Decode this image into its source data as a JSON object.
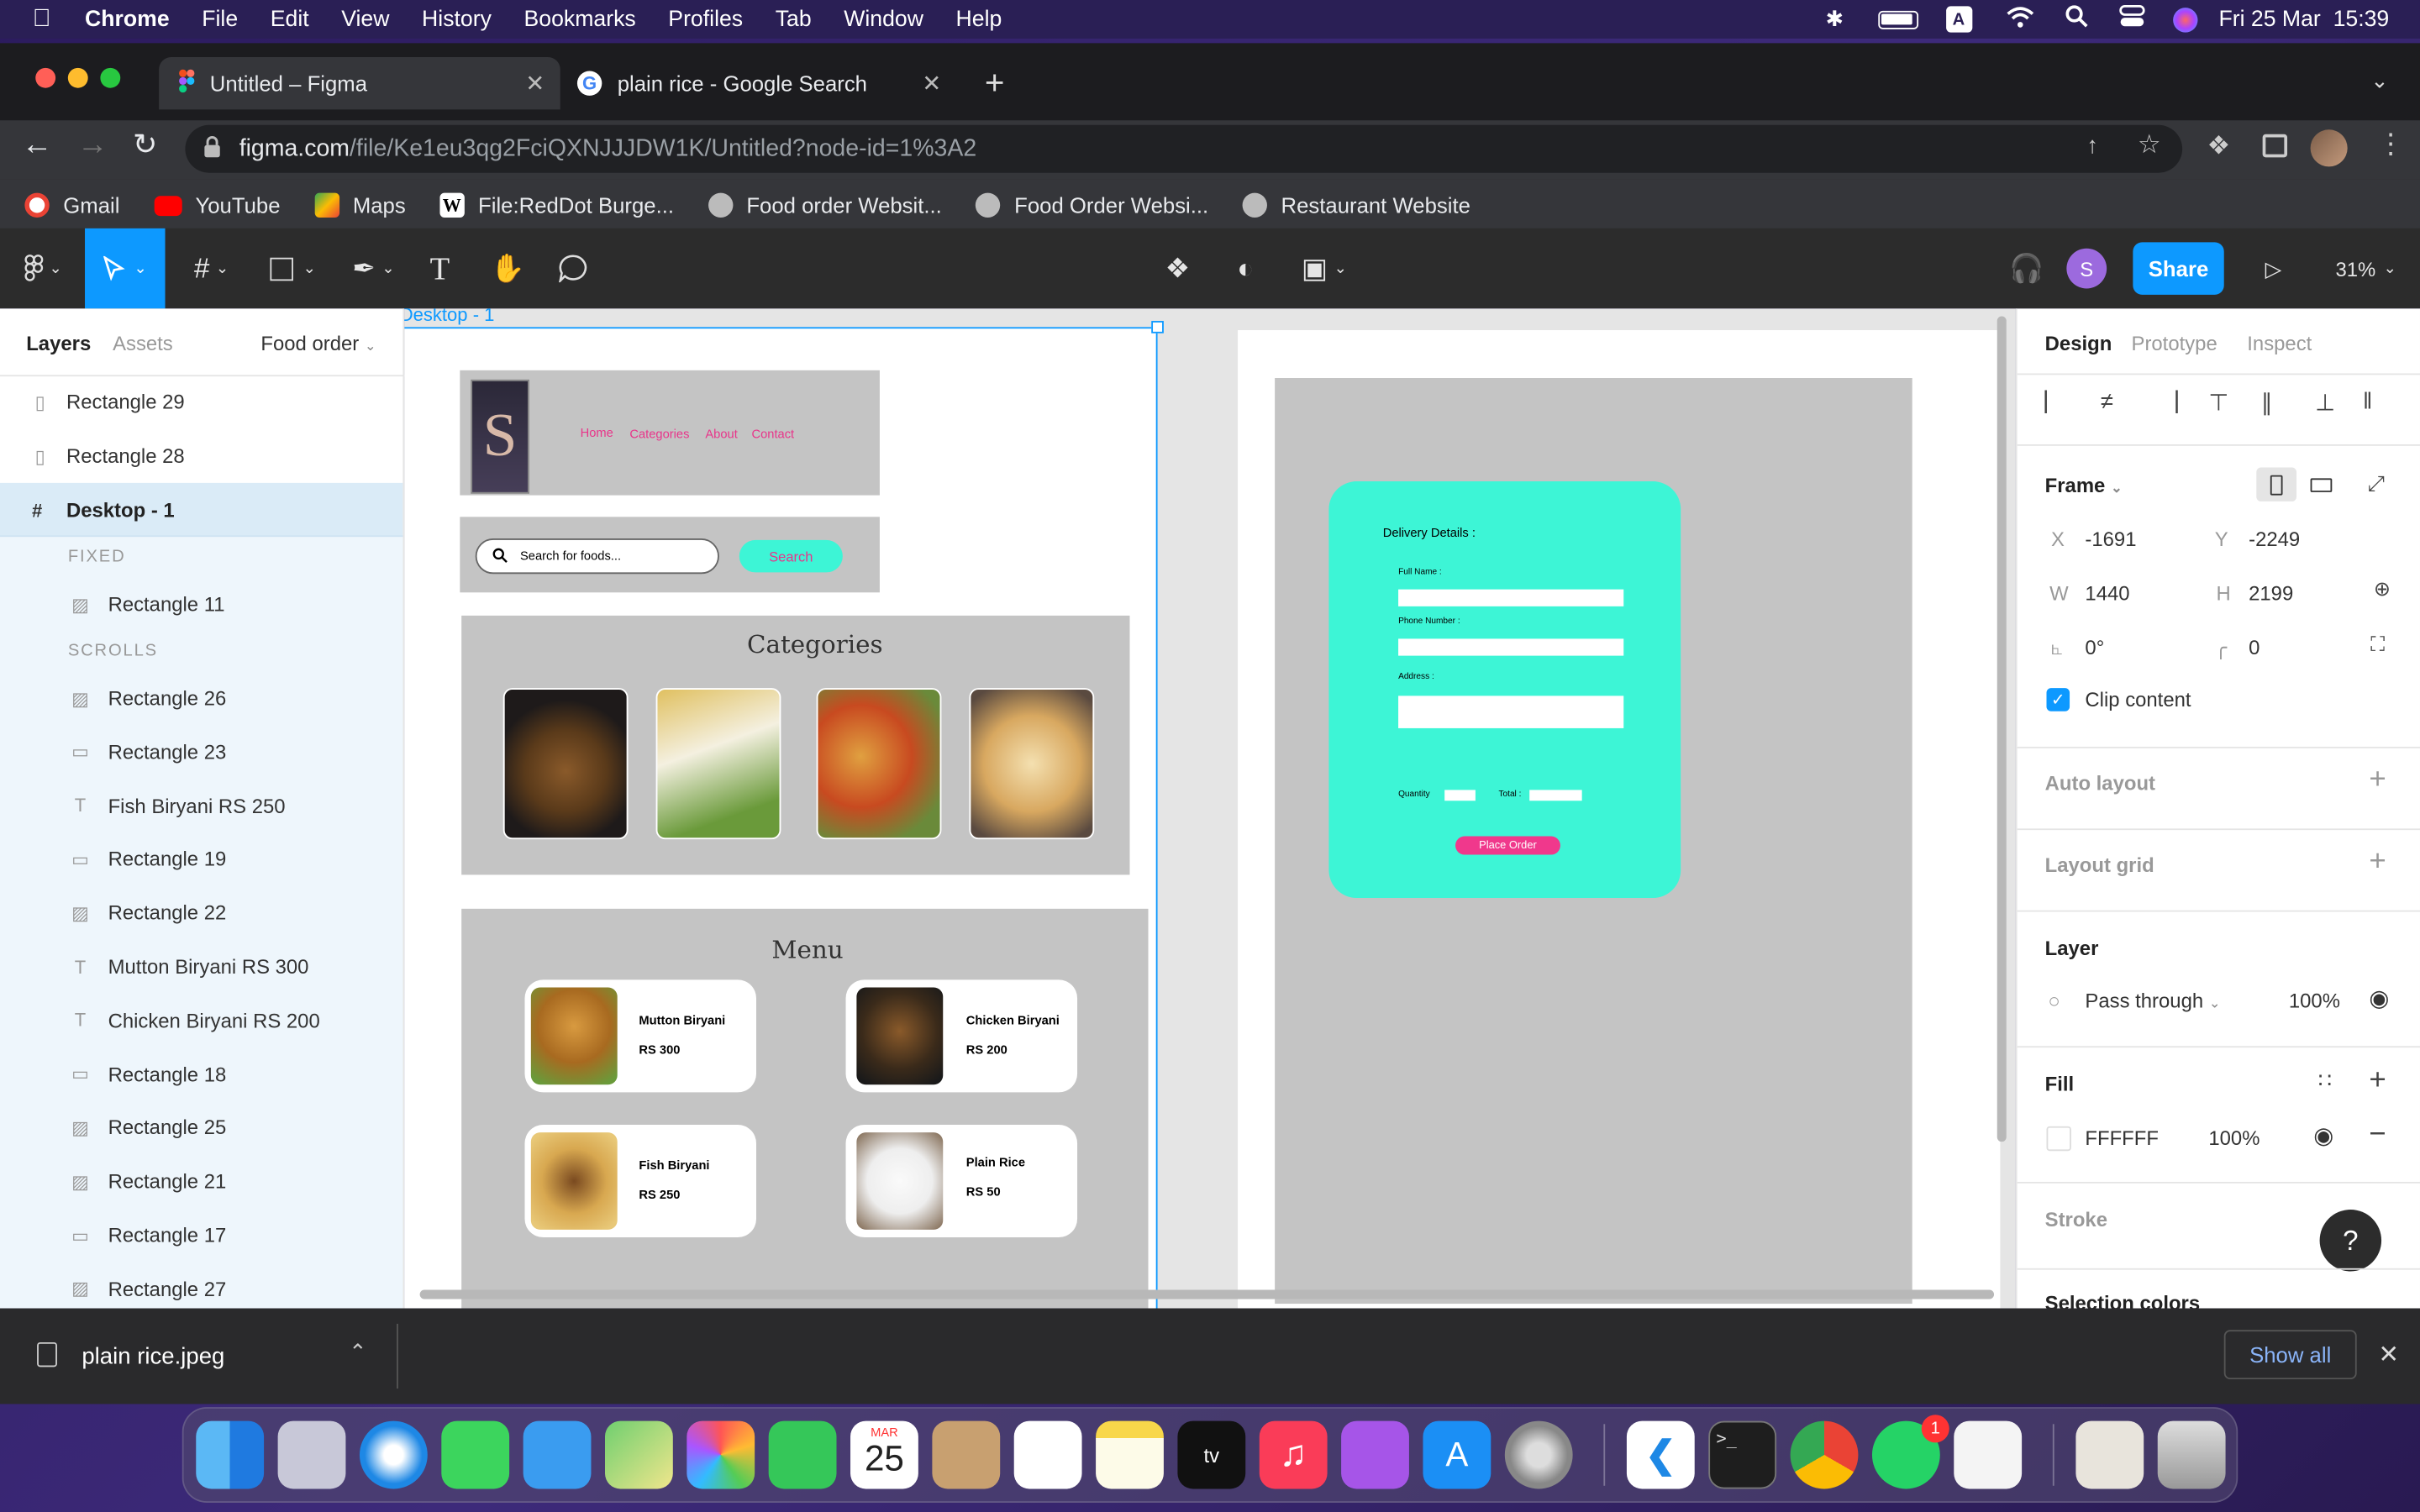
{
  "menubar": {
    "app": "Chrome",
    "items": [
      "File",
      "Edit",
      "View",
      "History",
      "Bookmarks",
      "Profiles",
      "Tab",
      "Window",
      "Help"
    ],
    "datetime": "Fri 25 Mar  15:39",
    "keyboard": "A"
  },
  "browser": {
    "tabs": [
      {
        "title": "Untitled – Figma",
        "icon": "figma-icon"
      },
      {
        "title": "plain rice - Google Search",
        "icon": "google-icon"
      }
    ],
    "url_host": "figma.com",
    "url_path": "/file/Ke1eu3qg2FciQXNJJJDW1K/Untitled?node-id=1%3A2",
    "bookmarks": [
      "Gmail",
      "YouTube",
      "Maps",
      "File:RedDot Burge...",
      "Food order Websit...",
      "Food Order Websi...",
      "Restaurant Website"
    ]
  },
  "figma_toolbar": {
    "avatar_letter": "S",
    "share_label": "Share",
    "zoom": "31%"
  },
  "left_panel": {
    "tabs": [
      "Layers",
      "Assets"
    ],
    "page": "Food order",
    "layers_top": [
      "Rectangle 29",
      "Rectangle 28"
    ],
    "selected": "Desktop - 1",
    "section_fixed": "FIXED",
    "fixed_layers": [
      "Rectangle 11"
    ],
    "section_scrolls": "SCROLLS",
    "scroll_layers": [
      {
        "name": "Rectangle 26",
        "type": "image"
      },
      {
        "name": "Rectangle 23",
        "type": "rect"
      },
      {
        "name": "Fish Biryani RS 250",
        "type": "text"
      },
      {
        "name": "Rectangle 19",
        "type": "rect"
      },
      {
        "name": "Rectangle 22",
        "type": "image"
      },
      {
        "name": "Mutton Biryani RS 300",
        "type": "text"
      },
      {
        "name": "Chicken Biryani RS 200",
        "type": "text"
      },
      {
        "name": "Rectangle 18",
        "type": "rect"
      },
      {
        "name": "Rectangle 25",
        "type": "image"
      },
      {
        "name": "Rectangle 21",
        "type": "image"
      },
      {
        "name": "Rectangle 17",
        "type": "rect"
      },
      {
        "name": "Rectangle 27",
        "type": "image"
      }
    ]
  },
  "canvas": {
    "frame_label": "Desktop - 1",
    "nav": [
      "Home",
      "Categories",
      "About",
      "Contact"
    ],
    "search_placeholder": "Search for foods...",
    "search_button": "Search",
    "categories_title": "Categories",
    "menu_title": "Menu",
    "menu_items": [
      {
        "name": "Mutton Biryani",
        "price": "RS 300"
      },
      {
        "name": "Chicken Biryani",
        "price": "RS 200"
      },
      {
        "name": "Fish Biryani",
        "price": "RS 250"
      },
      {
        "name": "Plain Rice",
        "price": "RS 50"
      }
    ],
    "delivery": {
      "title": "Delivery Details :",
      "full_name": "Full Name :",
      "phone": "Phone Number :",
      "address": "Address :",
      "quantity": "Quantity",
      "total": "Total :",
      "button": "Place Order"
    }
  },
  "right_panel": {
    "tabs": [
      "Design",
      "Prototype",
      "Inspect"
    ],
    "frame_label": "Frame",
    "x_label": "X",
    "x": "-1691",
    "y_label": "Y",
    "y": "-2249",
    "w_label": "W",
    "w": "1440",
    "h_label": "H",
    "h": "2199",
    "rotation": "0°",
    "radius": "0",
    "clip_content": "Clip content",
    "auto_layout": "Auto layout",
    "layout_grid": "Layout grid",
    "layer_title": "Layer",
    "blend": "Pass through",
    "opacity": "100%",
    "fill_title": "Fill",
    "fill_hex": "FFFFFF",
    "fill_opacity": "100%",
    "stroke_title": "Stroke",
    "selection_colors": "Selection colors",
    "help": "?"
  },
  "download_bar": {
    "file": "plain rice.jpeg",
    "show_all": "Show all"
  },
  "dock": {
    "calendar_month": "MAR",
    "calendar_day": "25",
    "whatsapp_badge": "1"
  },
  "colors": {
    "figma_blue": "#0d99ff",
    "mock_teal": "#3df5d6",
    "mock_pink": "#f0388c",
    "mock_gray": "#c4c4c4"
  }
}
